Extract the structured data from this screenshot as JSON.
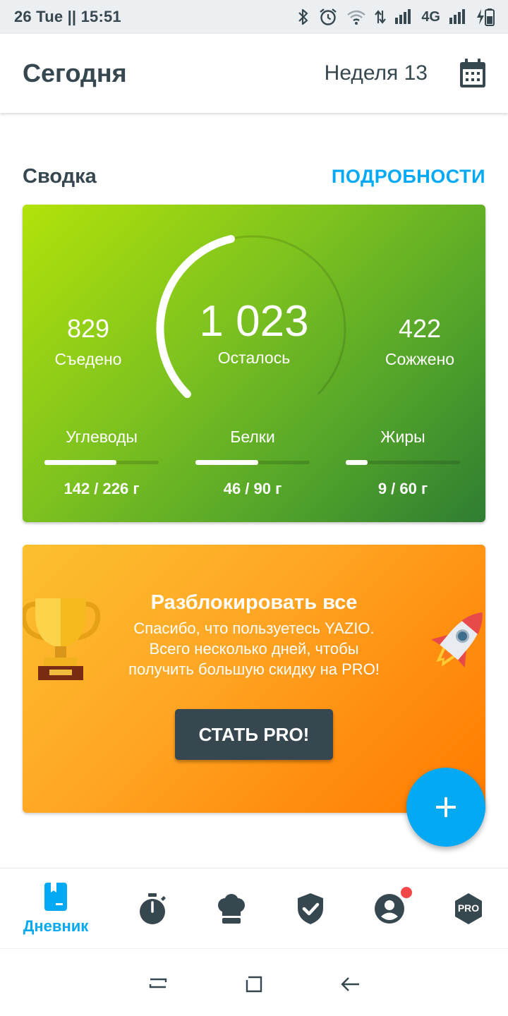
{
  "status_bar": {
    "time_text": "26 Tue || 15:51",
    "network": "4G",
    "icons": [
      "bluetooth-icon",
      "alarm-icon",
      "wifi-icon",
      "data-arrows-icon",
      "signal-icon",
      "signal-icon",
      "battery-charging-icon"
    ]
  },
  "app_bar": {
    "title": "Сегодня",
    "week": "Неделя 13",
    "calendar_icon": "calendar-icon"
  },
  "summary": {
    "title": "Сводка",
    "details_link": "ПОДРОБНОСТИ",
    "eaten_value": "829",
    "eaten_label": "Съедено",
    "remaining_value": "1 023",
    "remaining_label": "Осталось",
    "burned_value": "422",
    "burned_label": "Сожжено",
    "ring_progress": 0.45,
    "macros": [
      {
        "name": "Углеводы",
        "amount": "142 / 226 г",
        "progress": 0.63
      },
      {
        "name": "Белки",
        "amount": "46 / 90 г",
        "progress": 0.55
      },
      {
        "name": "Жиры",
        "amount": "9 / 60 г",
        "progress": 0.19
      }
    ],
    "colors": {
      "card_start": "#b2e20a",
      "card_end": "#2f7d32",
      "link": "#03a9f4"
    }
  },
  "promo": {
    "title": "Разблокировать все",
    "line1": "Спасибо, что пользуетесь YAZIO.",
    "line2": "Всего несколько дней, чтобы",
    "line3": "получить большую скидку на PRO!",
    "button": "СТАТЬ PRO!",
    "colors": {
      "card_start": "#fbc02d",
      "card_end": "#ff7b00",
      "button": "#37474f"
    }
  },
  "fab": {
    "icon": "plus-icon",
    "color": "#03a9f4"
  },
  "bottom_nav": {
    "items": [
      {
        "icon": "diary-icon",
        "label": "Дневник",
        "active": true
      },
      {
        "icon": "stopwatch-icon",
        "label": ""
      },
      {
        "icon": "chef-hat-icon",
        "label": ""
      },
      {
        "icon": "shield-check-icon",
        "label": ""
      },
      {
        "icon": "profile-icon",
        "label": "",
        "badge": true
      },
      {
        "icon": "pro-badge-icon",
        "label": "PRO"
      }
    ],
    "active_color": "#03a9f4"
  },
  "system_nav": [
    "recents-icon",
    "home-icon",
    "back-icon"
  ]
}
